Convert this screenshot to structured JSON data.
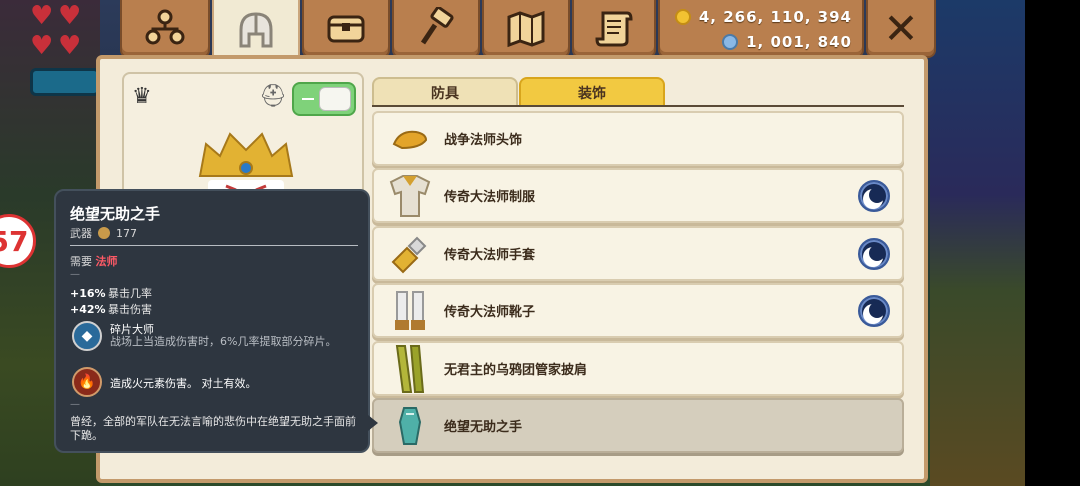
{
  "hud": {
    "hearts": [
      "heart",
      "heart",
      "heart",
      "heart"
    ],
    "badge": "57"
  },
  "tabs": [
    {
      "name": "tab-skills",
      "icon": "skill-tree-icon"
    },
    {
      "name": "tab-equipment",
      "icon": "helmet-icon",
      "active": true
    },
    {
      "name": "tab-inventory",
      "icon": "chest-icon"
    },
    {
      "name": "tab-crafting",
      "icon": "hammer-icon"
    },
    {
      "name": "tab-map",
      "icon": "map-icon"
    },
    {
      "name": "tab-quests",
      "icon": "scroll-icon"
    }
  ],
  "currency": {
    "gold": "4, 266, 110, 394",
    "gems": "1, 001, 840"
  },
  "close_icon": "close-icon",
  "preview": {
    "toggle_on": true
  },
  "subtabs": {
    "armor": "防具",
    "decoration": "装饰",
    "active": "decoration"
  },
  "items": [
    {
      "label": "战争法师头饰",
      "enchant": false
    },
    {
      "label": "传奇大法师制服",
      "enchant": true
    },
    {
      "label": "传奇大法师手套",
      "enchant": true
    },
    {
      "label": "传奇大法师靴子",
      "enchant": true
    },
    {
      "label": "无君主的乌鸦团管家披肩",
      "enchant": false
    },
    {
      "label": "绝望无助之手",
      "enchant": false,
      "selected": true
    }
  ],
  "tooltip": {
    "title": "绝望无助之手",
    "type": "武器",
    "power": "177",
    "require_label": "需要",
    "require_class": "法师",
    "dash": "—",
    "stats": [
      {
        "value": "+16%",
        "label": "暴击几率"
      },
      {
        "value": "+42%",
        "label": "暴击伤害"
      }
    ],
    "enchant_name": "碎片大师",
    "enchant_desc": "战场上当造成伤害时，6%几率提取部分碎片。",
    "fire_desc": "造成火元素伤害。 对土有效。",
    "lore": "曾经，全部的军队在无法言喻的悲伤中在绝望无助之手面前下跪。"
  },
  "colors": {
    "panel": "#f3ecda",
    "tab": "#b97f4e",
    "accent_yellow": "#f2c941",
    "class_red": "#ff5a66",
    "tooltip_bg": "#2e3640"
  }
}
